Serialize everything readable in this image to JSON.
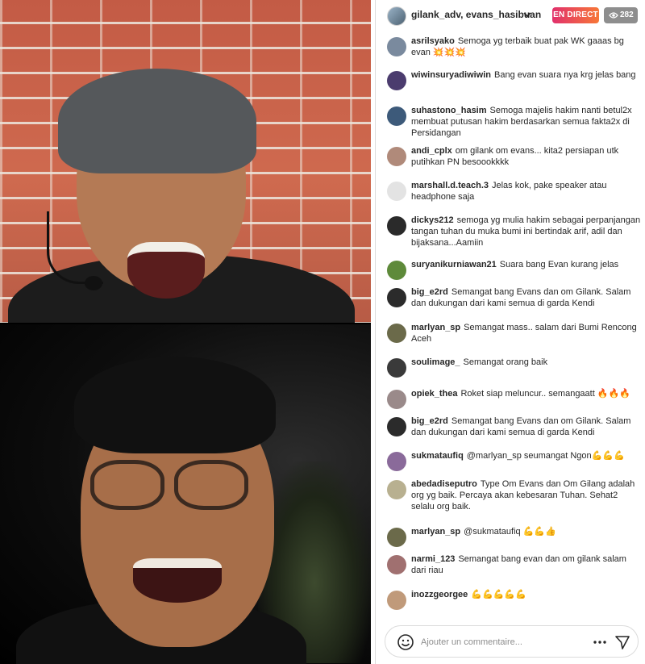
{
  "header": {
    "title": "gilank_adv, evans_hasibuan",
    "live_label": "EN DIRECT",
    "viewer_count": "282"
  },
  "comments": [
    {
      "user": "asrilsyako",
      "text": "Semoga yg terbaik buat pak WK gaaas bg evan 💥💥💥",
      "avatar_color": "#7a8a9e"
    },
    {
      "user": "wiwinsuryadiwiwin",
      "text": "Bang evan suara nya krg jelas bang",
      "avatar_color": "#4b3c6e"
    },
    {
      "user": "suhastono_hasim",
      "text": "Semoga majelis hakim nanti betul2x membuat putusan hakim berdasarkan semua fakta2x di Persidangan",
      "avatar_color": "#3d5a7a"
    },
    {
      "user": "andi_cplx",
      "text": "om gilank om evans... kita2 persiapan utk putihkan PN besoookkkk",
      "avatar_color": "#b08a7a"
    },
    {
      "user": "marshall.d.teach.3",
      "text": "Jelas kok, pake speaker atau headphone saja",
      "avatar_color": "#e3e3e3"
    },
    {
      "user": "dickys212",
      "text": "semoga yg mulia hakim sebagai perpanjangan tangan tuhan du muka bumi ini bertindak arif, adil dan bijaksana...Aamiin",
      "avatar_color": "#2a2a2a"
    },
    {
      "user": "suryanikurniawan21",
      "text": "Suara bang Evan kurang jelas",
      "avatar_color": "#5e8a3a"
    },
    {
      "user": "big_e2rd",
      "text": "Semangat bang Evans dan om Gilank. Salam dan dukungan dari kami semua di garda Kendi",
      "avatar_color": "#2b2b2b"
    },
    {
      "user": "marlyan_sp",
      "text": "Semangat mass.. salam dari Bumi Rencong Aceh",
      "avatar_color": "#6b6a4a"
    },
    {
      "user": "soulimage_",
      "text": "Semangat orang baik",
      "avatar_color": "#3a3a3a"
    },
    {
      "user": "opiek_thea",
      "text": "Roket siap meluncur.. semangaatt 🔥🔥🔥",
      "avatar_color": "#9a8a8a"
    },
    {
      "user": "big_e2rd",
      "text": "Semangat bang Evans dan om Gilank. Salam dan dukungan dari kami semua di garda Kendi",
      "avatar_color": "#2b2b2b"
    },
    {
      "user": "sukmataufiq",
      "text": "@marlyan_sp seumangat Ngon💪💪💪",
      "avatar_color": "#8a6a9a"
    },
    {
      "user": "abedadiseputro",
      "text": "Type Om Evans dan Om Gilang adalah org yg baik. Percaya akan kebesaran Tuhan. Sehat2 selalu org baik.",
      "avatar_color": "#b8b090"
    },
    {
      "user": "marlyan_sp",
      "text": "@sukmataufiq 💪💪👍",
      "avatar_color": "#6b6a4a"
    },
    {
      "user": "narmi_123",
      "text": "Semangat bang evan dan om gilank salam dari riau",
      "avatar_color": "#a07070"
    },
    {
      "user": "inozzgeorgee",
      "text": "💪💪💪💪💪",
      "avatar_color": "#c09a7a"
    }
  ],
  "composer": {
    "placeholder": "Ajouter un commentaire..."
  }
}
